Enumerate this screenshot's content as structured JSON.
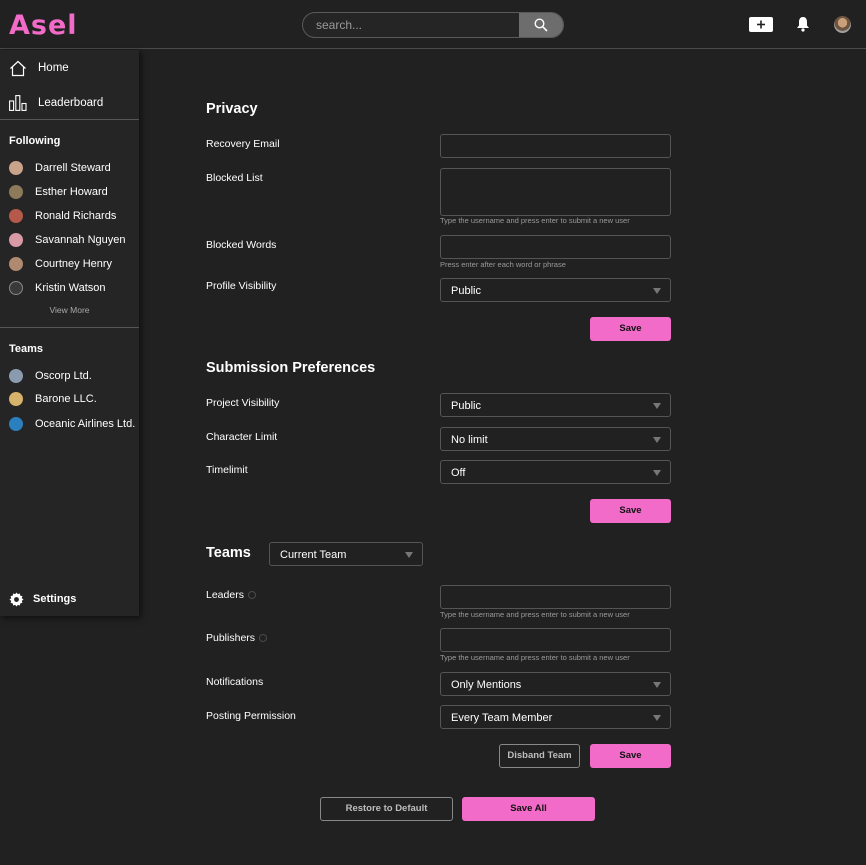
{
  "app": {
    "logo_text": "Asel",
    "search": {
      "placeholder": "search..."
    }
  },
  "sidebar": {
    "nav": [
      {
        "label": "Home",
        "icon": "home-icon"
      },
      {
        "label": "Leaderboard",
        "icon": "leaderboard-icon"
      }
    ],
    "following_title": "Following",
    "following": [
      {
        "name": "Darrell Steward",
        "color": "#c9a38a"
      },
      {
        "name": "Esther Howard",
        "color": "#8c7a5a"
      },
      {
        "name": "Ronald Richards",
        "color": "#b55a4a"
      },
      {
        "name": "Savannah Nguyen",
        "color": "#d99aa8"
      },
      {
        "name": "Courtney Henry",
        "color": "#b08a70"
      },
      {
        "name": "Kristin Watson",
        "color": "#3a3a3a"
      }
    ],
    "view_more": "View More",
    "teams_title": "Teams",
    "teams": [
      {
        "name": "Oscorp Ltd.",
        "color": "#8a9bb0"
      },
      {
        "name": "Barone LLC.",
        "color": "#d6b26a"
      },
      {
        "name": "Oceanic Airlines Ltd.",
        "color": "#2a7fbf"
      }
    ],
    "settings_label": "Settings"
  },
  "privacy": {
    "title": "Privacy",
    "recovery_email_label": "Recovery Email",
    "blocked_list_label": "Blocked List",
    "blocked_list_hint": "Type the username and press enter to submit a new user",
    "blocked_words_label": "Blocked Words",
    "blocked_words_hint": "Press enter after each word or phrase",
    "profile_visibility_label": "Profile Visibility",
    "profile_visibility_value": "Public",
    "save_label": "Save"
  },
  "submission": {
    "title": "Submission Preferences",
    "project_visibility_label": "Project Visibility",
    "project_visibility_value": "Public",
    "character_limit_label": "Character Limit",
    "character_limit_value": "No limit",
    "timelimit_label": "Timelimit",
    "timelimit_value": "Off",
    "save_label": "Save"
  },
  "teams": {
    "title": "Teams",
    "team_select_value": "Current Team",
    "leaders_label": "Leaders",
    "leaders_hint": "Type the username and press enter to submit a new user",
    "publishers_label": "Publishers",
    "publishers_hint": "Type the username and press enter to submit a new user",
    "notifications_label": "Notifications",
    "notifications_value": "Only Mentions",
    "posting_permission_label": "Posting Permission",
    "posting_permission_value": "Every Team Member",
    "disband_label": "Disband Team",
    "save_label": "Save"
  },
  "footer": {
    "restore_label": "Restore to Default",
    "save_all_label": "Save All"
  },
  "colors": {
    "accent": "#f26bc8",
    "background": "#212121",
    "sidebar": "#252525"
  }
}
